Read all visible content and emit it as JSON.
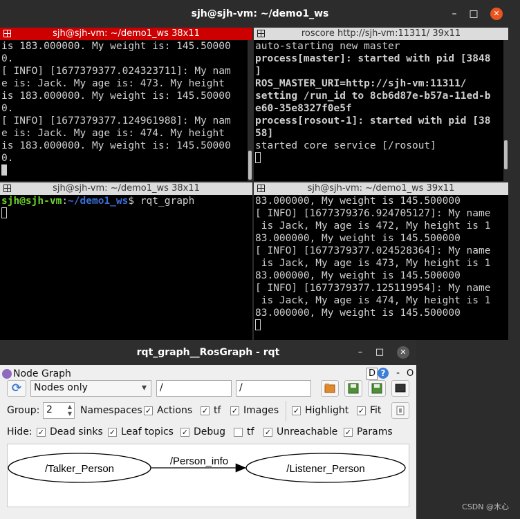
{
  "window": {
    "title": "sjh@sjh-vm: ~/demo1_ws",
    "minimize": "–",
    "maximize": "□",
    "close": "✕"
  },
  "panes": {
    "top_left": {
      "title": "sjh@sjh-vm: ~/demo1_ws 38x11",
      "lines": [
        "is 183.000000. My weight is: 145.50000",
        "0.",
        "[ INFO] [1677379377.024323711]: My nam",
        "e is: Jack. My age is: 473. My height",
        "is 183.000000. My weight is: 145.50000",
        "0.",
        "[ INFO] [1677379377.124961988]: My nam",
        "e is: Jack. My age is: 474. My height",
        "is 183.000000. My weight is: 145.50000",
        "0."
      ]
    },
    "top_right": {
      "title": "roscore http://sjh-vm:11311/ 39x11",
      "lines": [
        "auto-starting new master",
        "process[master]: started with pid [3848",
        "]",
        "ROS_MASTER_URI=http://sjh-vm:11311/",
        "",
        "setting /run_id to 8cb6d87e-b57a-11ed-b",
        "e60-35e8327f0e5f",
        "process[rosout-1]: started with pid [38",
        "58]",
        "started core service [/rosout]"
      ]
    },
    "bottom_left": {
      "title": "sjh@sjh-vm: ~/demo1_ws 38x11",
      "prompt_user": "sjh@sjh-vm",
      "prompt_sep": ":",
      "prompt_path": "~/demo1_ws",
      "prompt_end": "$ ",
      "command": "rqt_graph"
    },
    "bottom_right": {
      "title": "sjh@sjh-vm: ~/demo1_ws 39x11",
      "lines": [
        "83.000000, My weight is 145.500000",
        "[ INFO] [1677379376.924705127]: My name",
        " is Jack, My age is 472, My height is 1",
        "83.000000, My weight is 145.500000",
        "[ INFO] [1677379377.024528364]: My name",
        " is Jack, My age is 473, My height is 1",
        "83.000000, My weight is 145.500000",
        "[ INFO] [1677379377.125119954]: My name",
        " is Jack, My age is 474, My height is 1",
        "83.000000, My weight is 145.500000"
      ]
    }
  },
  "rqt": {
    "title": "rqt_graph__RosGraph - rqt",
    "minimize": "–",
    "maximize": "□",
    "close": "✕",
    "plugin_title": "Node Graph",
    "plugin_d": "D",
    "plugin_help": "?",
    "plugin_dash": "-",
    "plugin_o": "O",
    "refresh_icon": "⟳",
    "mode_select": "Nodes only",
    "dropdown_icon": "▾",
    "filter1": "/",
    "filter2": "/",
    "group_label": "Group:",
    "group_value": "2",
    "check_mark": "✓",
    "options": {
      "namespaces": "Namespaces",
      "actions": "Actions",
      "tf": "tf",
      "images": "Images",
      "highlight": "Highlight",
      "fit": "Fit"
    },
    "hide_label": "Hide:",
    "hide": {
      "dead_sinks": "Dead sinks",
      "leaf_topics": "Leaf topics",
      "debug": "Debug",
      "tf": "tf",
      "unreachable": "Unreachable",
      "params": "Params"
    },
    "graph": {
      "source_node": "/Talker_Person",
      "topic": "/Person_info",
      "target_node": "/Listener_Person"
    }
  },
  "watermark": "CSDN @木心"
}
